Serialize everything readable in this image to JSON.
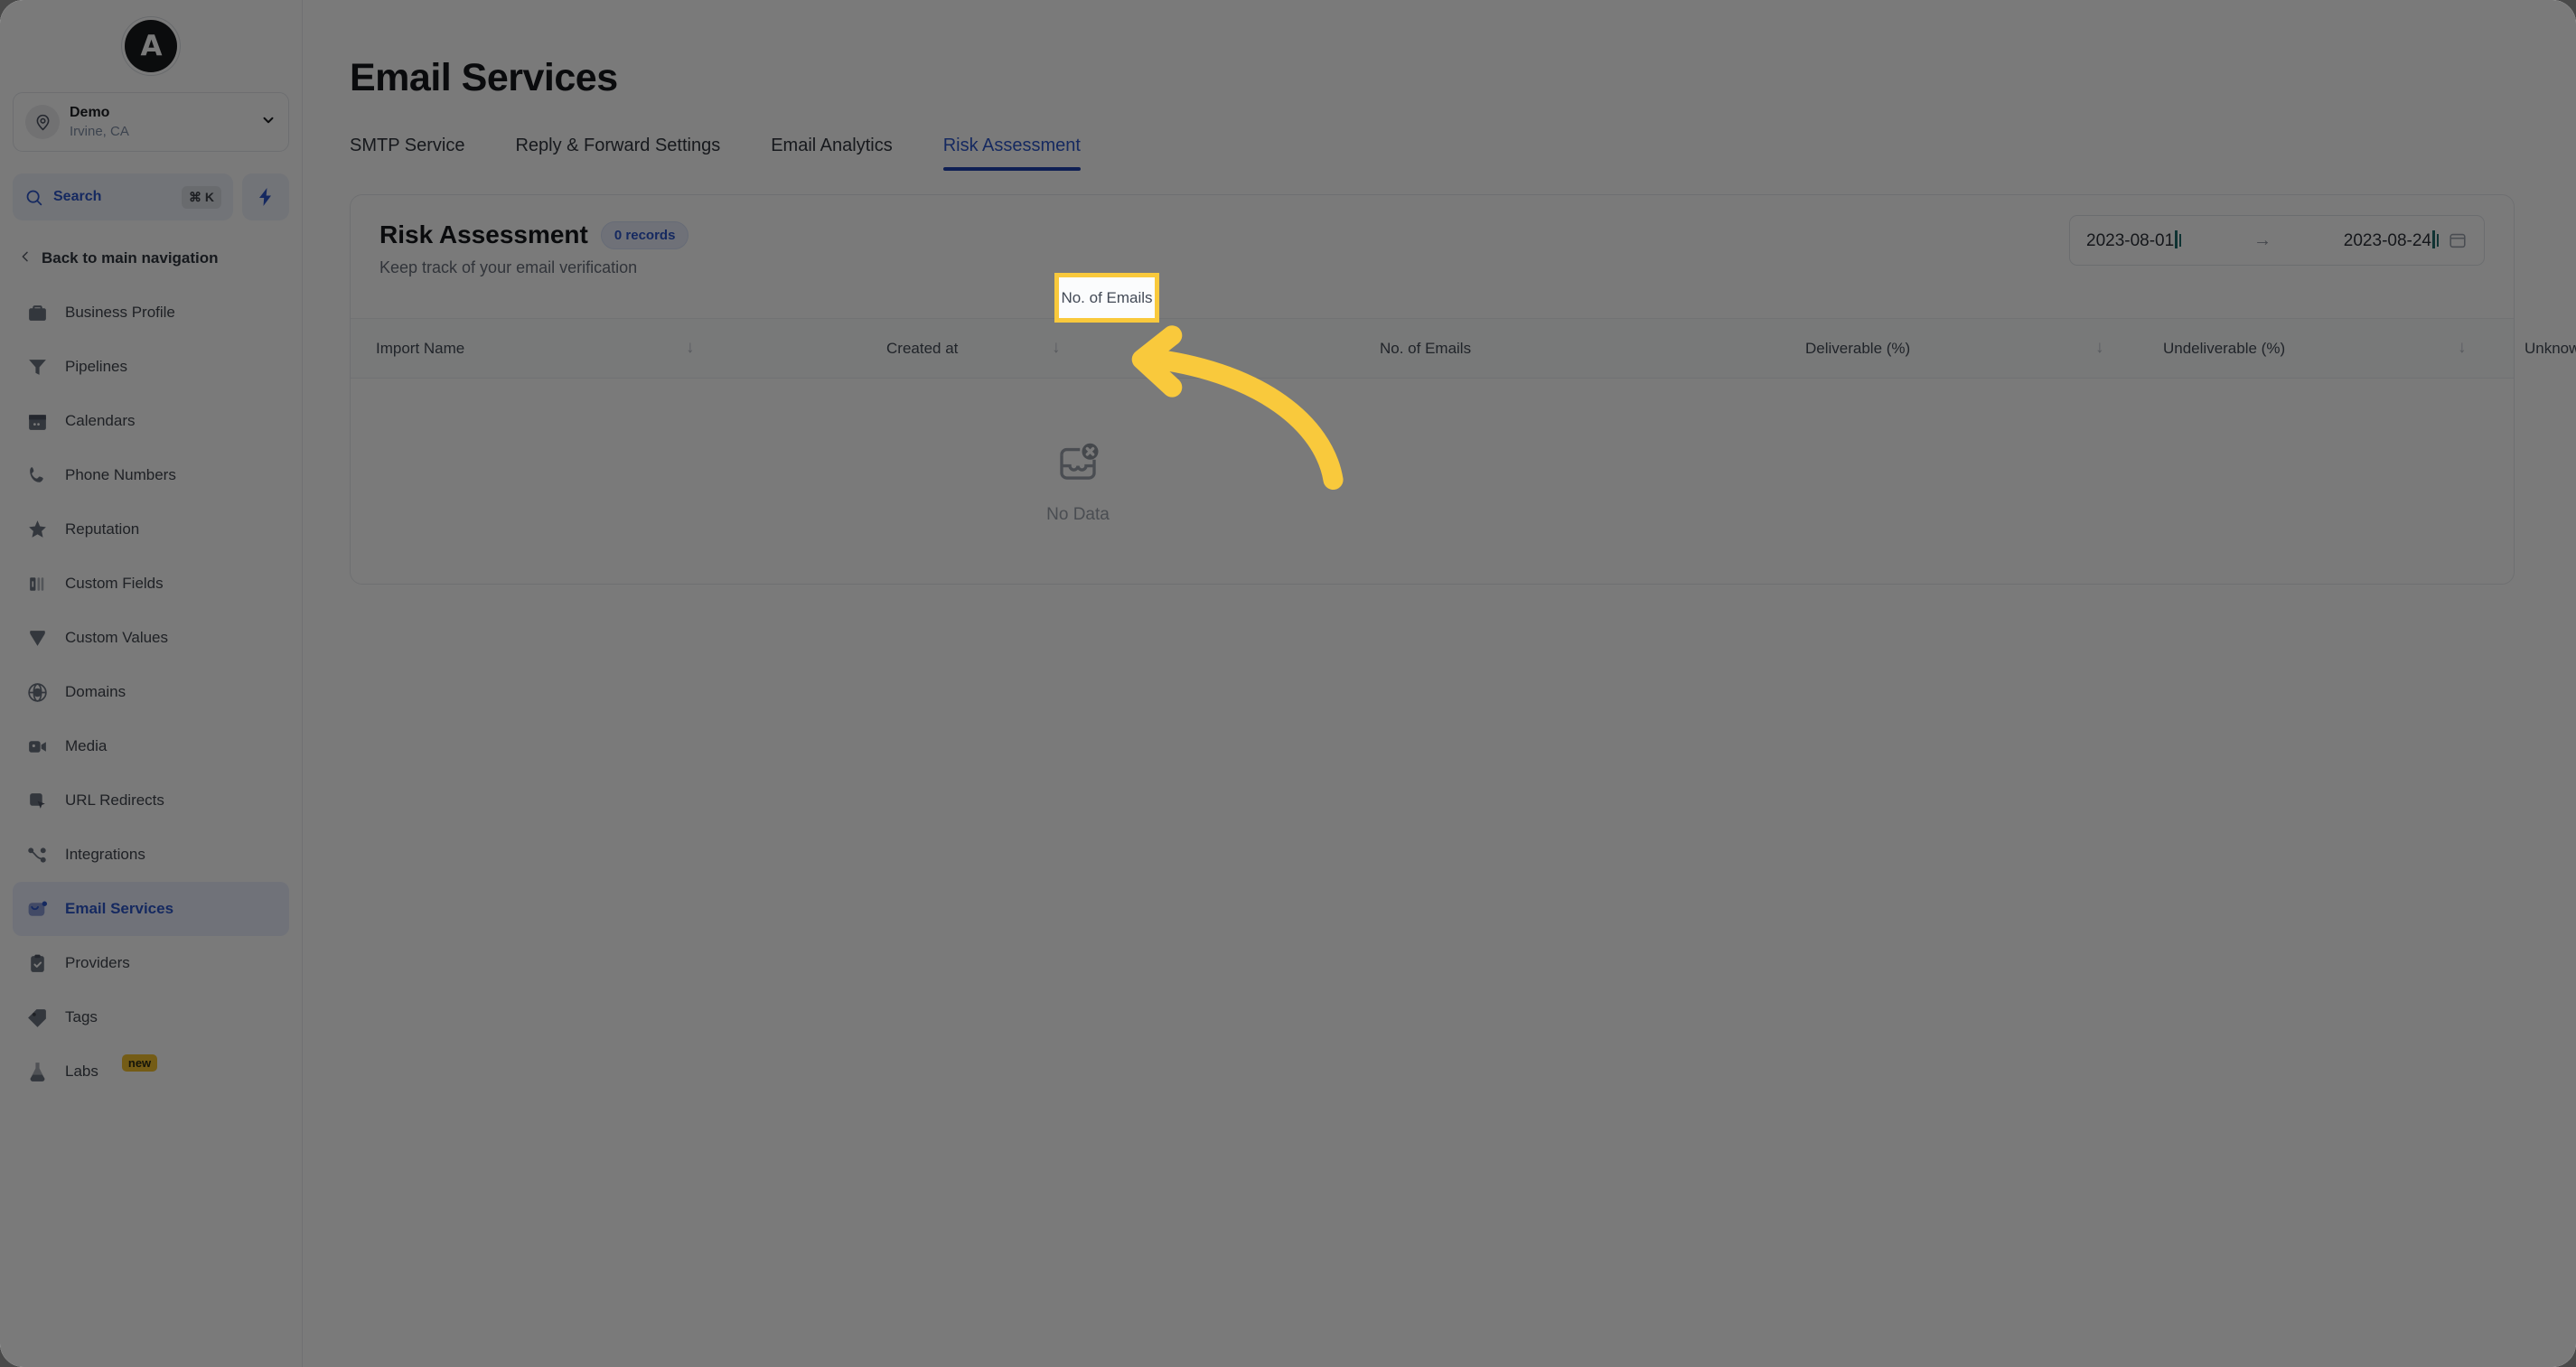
{
  "brand": {
    "logo_letter": "A",
    "accent": "#2c54c8",
    "highlight": "#f9c93c"
  },
  "sidebar": {
    "location": {
      "name": "Demo",
      "sub": "Irvine, CA"
    },
    "search": {
      "label": "Search",
      "shortcut": "⌘ K"
    },
    "back_nav": "Back to main navigation",
    "items": [
      {
        "label": "Business Profile",
        "icon": "briefcase-icon",
        "active": false
      },
      {
        "label": "Pipelines",
        "icon": "funnel-icon",
        "active": false
      },
      {
        "label": "Calendars",
        "icon": "calendar-icon",
        "active": false
      },
      {
        "label": "Phone Numbers",
        "icon": "phone-icon",
        "active": false
      },
      {
        "label": "Reputation",
        "icon": "star-icon",
        "active": false
      },
      {
        "label": "Custom Fields",
        "icon": "columns-icon",
        "active": false
      },
      {
        "label": "Custom Values",
        "icon": "gem-icon",
        "active": false
      },
      {
        "label": "Domains",
        "icon": "globe-icon",
        "active": false
      },
      {
        "label": "Media",
        "icon": "video-icon",
        "active": false
      },
      {
        "label": "URL Redirects",
        "icon": "pointer-square-icon",
        "active": false
      },
      {
        "label": "Integrations",
        "icon": "nodes-icon",
        "active": false
      },
      {
        "label": "Email Services",
        "icon": "envelope-icon",
        "active": true
      },
      {
        "label": "Providers",
        "icon": "clipboard-check-icon",
        "active": false
      },
      {
        "label": "Tags",
        "icon": "tag-icon",
        "active": false
      },
      {
        "label": "Labs",
        "icon": "flask-icon",
        "active": false,
        "badge": "new"
      }
    ]
  },
  "main": {
    "page_title": "Email Services",
    "tabs": [
      {
        "label": "SMTP Service",
        "active": false
      },
      {
        "label": "Reply & Forward Settings",
        "active": false
      },
      {
        "label": "Email Analytics",
        "active": false
      },
      {
        "label": "Risk Assessment",
        "active": true
      }
    ],
    "card": {
      "title": "Risk Assessment",
      "records_badge": "0 records",
      "subtitle": "Keep track of your email verification",
      "date_range": {
        "start": "2023-08-01",
        "end": "2023-08-24",
        "separator": "→"
      },
      "columns": [
        {
          "label": "Import Name",
          "sortable": true
        },
        {
          "label": "Created at",
          "sortable": true
        },
        {
          "label": "No. of Emails",
          "sortable": false,
          "highlighted": true
        },
        {
          "label": "Deliverable (%)",
          "sortable": true
        },
        {
          "label": "Undeliverable (%)",
          "sortable": true
        },
        {
          "label": "Unknown (%)",
          "sortable": true
        }
      ],
      "empty_state": {
        "label": "No Data",
        "icon": "inbox-x-icon"
      }
    }
  }
}
